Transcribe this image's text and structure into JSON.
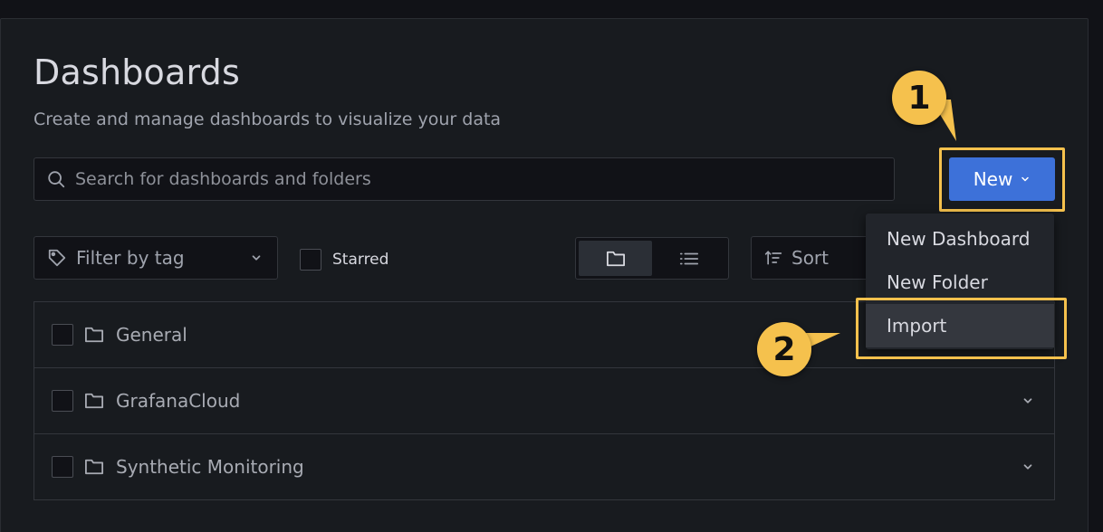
{
  "header": {
    "title": "Dashboards",
    "subtitle": "Create and manage dashboards to visualize your data"
  },
  "search": {
    "placeholder": "Search for dashboards and folders",
    "value": ""
  },
  "new_button": {
    "label": "New"
  },
  "new_menu": {
    "items": [
      {
        "label": "New Dashboard"
      },
      {
        "label": "New Folder"
      },
      {
        "label": "Import"
      }
    ]
  },
  "filters": {
    "tag_placeholder": "Filter by tag",
    "starred_label": "Starred",
    "starred_checked": false,
    "sort_label": "Sort",
    "view_mode": "folders"
  },
  "folders": [
    {
      "name": "General"
    },
    {
      "name": "GrafanaCloud"
    },
    {
      "name": "Synthetic Monitoring"
    }
  ],
  "callouts": {
    "step1": "1",
    "step2": "2"
  },
  "colors": {
    "accent": "#3d71d9",
    "highlight": "#f5c14d",
    "background": "#181b1f"
  }
}
